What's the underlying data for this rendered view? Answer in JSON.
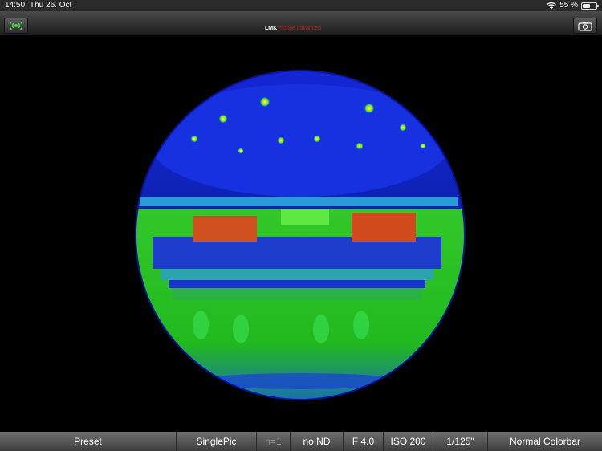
{
  "status_bar": {
    "time": "14:50",
    "date": "Thu 26. Oct",
    "battery": "55 %",
    "battery_level": 0.55
  },
  "toolbar": {
    "left_button_icon": "wireless-signal-icon",
    "logo_main": "LMK",
    "logo_sub": "mobile advanced",
    "right_button_icon": "camera-icon"
  },
  "viewer": {
    "description_icon": "fisheye-falsecolor-image"
  },
  "bottom_bar": {
    "preset": "Preset",
    "mode": "SinglePic",
    "count": "n=1",
    "nd_filter": "no ND",
    "aperture": "F 4.0",
    "iso": "ISO 200",
    "shutter": "1/125\"",
    "colorbar": "Normal Colorbar"
  }
}
